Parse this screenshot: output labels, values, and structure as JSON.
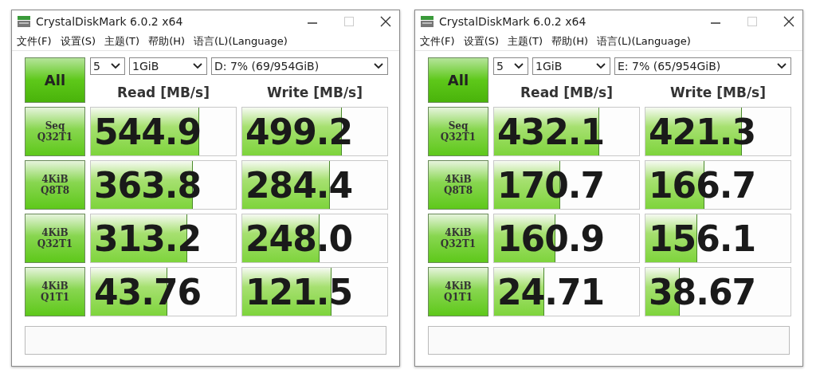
{
  "windows": [
    {
      "title": "CrystalDiskMark 6.0.2 x64",
      "menu": [
        "文件(F)",
        "设置(S)",
        "主题(T)",
        "帮助(H)",
        "语言(L)(Language)"
      ],
      "all_button": "All",
      "count": "5",
      "size": "1GiB",
      "drive": "D: 7% (69/954GiB)",
      "headers": [
        "Read [MB/s]",
        "Write [MB/s]"
      ],
      "rows": [
        {
          "label": [
            "Seq",
            "Q32T1"
          ],
          "read": {
            "value": "544.9",
            "level": 0.74
          },
          "write": {
            "value": "499.2",
            "level": 0.68
          }
        },
        {
          "label": [
            "4KiB",
            "Q8T8"
          ],
          "read": {
            "value": "363.8",
            "level": 0.7
          },
          "write": {
            "value": "284.4",
            "level": 0.6
          }
        },
        {
          "label": [
            "4KiB",
            "Q32T1"
          ],
          "read": {
            "value": "313.2",
            "level": 0.66
          },
          "write": {
            "value": "248.0",
            "level": 0.53
          }
        },
        {
          "label": [
            "4KiB",
            "Q1T1"
          ],
          "read": {
            "value": "43.76",
            "level": 0.52
          },
          "write": {
            "value": "121.5",
            "level": 0.61
          }
        }
      ]
    },
    {
      "title": "CrystalDiskMark 6.0.2 x64",
      "menu": [
        "文件(F)",
        "设置(S)",
        "主题(T)",
        "帮助(H)",
        "语言(L)(Language)"
      ],
      "all_button": "All",
      "count": "5",
      "size": "1GiB",
      "drive": "E: 7% (65/954GiB)",
      "headers": [
        "Read [MB/s]",
        "Write [MB/s]"
      ],
      "rows": [
        {
          "label": [
            "Seq",
            "Q32T1"
          ],
          "read": {
            "value": "432.1",
            "level": 0.72
          },
          "write": {
            "value": "421.3",
            "level": 0.66
          }
        },
        {
          "label": [
            "4KiB",
            "Q8T8"
          ],
          "read": {
            "value": "170.7",
            "level": 0.45
          },
          "write": {
            "value": "166.7",
            "level": 0.4
          }
        },
        {
          "label": [
            "4KiB",
            "Q32T1"
          ],
          "read": {
            "value": "160.9",
            "level": 0.42
          },
          "write": {
            "value": "156.1",
            "level": 0.35
          }
        },
        {
          "label": [
            "4KiB",
            "Q1T1"
          ],
          "read": {
            "value": "24.71",
            "level": 0.34
          },
          "write": {
            "value": "38.67",
            "level": 0.23
          }
        }
      ]
    }
  ]
}
